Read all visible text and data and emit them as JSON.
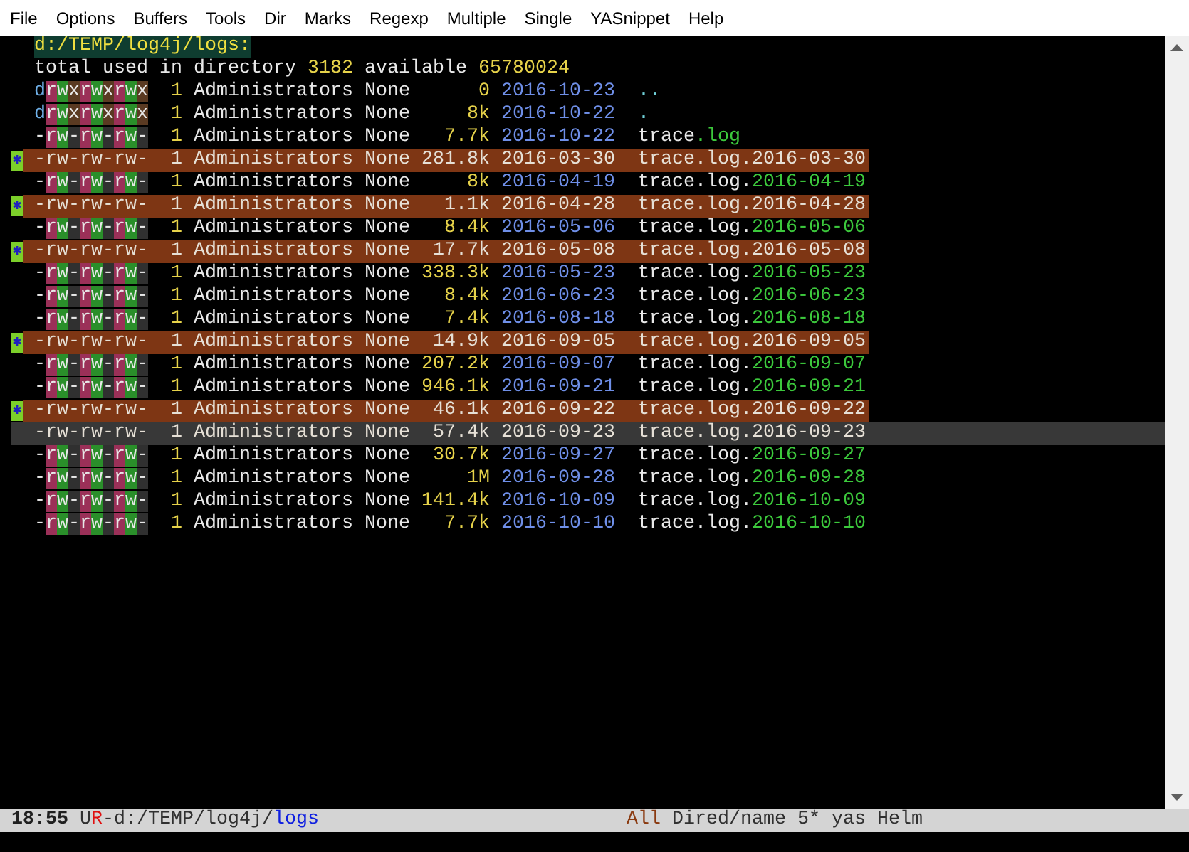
{
  "menu": [
    "File",
    "Options",
    "Buffers",
    "Tools",
    "Dir",
    "Marks",
    "Regexp",
    "Multiple",
    "Single",
    "YASnippet",
    "Help"
  ],
  "header": "d:/TEMP/log4j/logs:",
  "summary": {
    "text": "total used in directory",
    "used": "3182",
    "avail_label": "available",
    "avail": "65780024"
  },
  "rows": [
    {
      "kind": "dir",
      "marked": false,
      "current": false,
      "perms": "drwxrwxrwx",
      "links": "1",
      "owner": "Administrators",
      "group": "None",
      "size": "0",
      "date": "2016-10-23",
      "name": "..",
      "ext": ""
    },
    {
      "kind": "dir",
      "marked": false,
      "current": false,
      "perms": "drwxrwxrwx",
      "links": "1",
      "owner": "Administrators",
      "group": "None",
      "size": "8k",
      "date": "2016-10-22",
      "name": ".",
      "ext": ""
    },
    {
      "kind": "file",
      "marked": false,
      "current": false,
      "perms": "-rw-rw-rw-",
      "links": "1",
      "owner": "Administrators",
      "group": "None",
      "size": "7.7k",
      "date": "2016-10-22",
      "name": "trace",
      "ext": ".log"
    },
    {
      "kind": "file",
      "marked": true,
      "current": false,
      "perms": "-rw-rw-rw-",
      "links": "1",
      "owner": "Administrators",
      "group": "None",
      "size": "281.8k",
      "date": "2016-03-30",
      "name": "trace.log.",
      "ext": "2016-03-30"
    },
    {
      "kind": "file",
      "marked": false,
      "current": false,
      "perms": "-rw-rw-rw-",
      "links": "1",
      "owner": "Administrators",
      "group": "None",
      "size": "8k",
      "date": "2016-04-19",
      "name": "trace.log.",
      "ext": "2016-04-19"
    },
    {
      "kind": "file",
      "marked": true,
      "current": false,
      "perms": "-rw-rw-rw-",
      "links": "1",
      "owner": "Administrators",
      "group": "None",
      "size": "1.1k",
      "date": "2016-04-28",
      "name": "trace.log.",
      "ext": "2016-04-28"
    },
    {
      "kind": "file",
      "marked": false,
      "current": false,
      "perms": "-rw-rw-rw-",
      "links": "1",
      "owner": "Administrators",
      "group": "None",
      "size": "8.4k",
      "date": "2016-05-06",
      "name": "trace.log.",
      "ext": "2016-05-06"
    },
    {
      "kind": "file",
      "marked": true,
      "current": false,
      "perms": "-rw-rw-rw-",
      "links": "1",
      "owner": "Administrators",
      "group": "None",
      "size": "17.7k",
      "date": "2016-05-08",
      "name": "trace.log.",
      "ext": "2016-05-08"
    },
    {
      "kind": "file",
      "marked": false,
      "current": false,
      "perms": "-rw-rw-rw-",
      "links": "1",
      "owner": "Administrators",
      "group": "None",
      "size": "338.3k",
      "date": "2016-05-23",
      "name": "trace.log.",
      "ext": "2016-05-23"
    },
    {
      "kind": "file",
      "marked": false,
      "current": false,
      "perms": "-rw-rw-rw-",
      "links": "1",
      "owner": "Administrators",
      "group": "None",
      "size": "8.4k",
      "date": "2016-06-23",
      "name": "trace.log.",
      "ext": "2016-06-23"
    },
    {
      "kind": "file",
      "marked": false,
      "current": false,
      "perms": "-rw-rw-rw-",
      "links": "1",
      "owner": "Administrators",
      "group": "None",
      "size": "7.4k",
      "date": "2016-08-18",
      "name": "trace.log.",
      "ext": "2016-08-18"
    },
    {
      "kind": "file",
      "marked": true,
      "current": false,
      "perms": "-rw-rw-rw-",
      "links": "1",
      "owner": "Administrators",
      "group": "None",
      "size": "14.9k",
      "date": "2016-09-05",
      "name": "trace.log.",
      "ext": "2016-09-05"
    },
    {
      "kind": "file",
      "marked": false,
      "current": false,
      "perms": "-rw-rw-rw-",
      "links": "1",
      "owner": "Administrators",
      "group": "None",
      "size": "207.2k",
      "date": "2016-09-07",
      "name": "trace.log.",
      "ext": "2016-09-07"
    },
    {
      "kind": "file",
      "marked": false,
      "current": false,
      "perms": "-rw-rw-rw-",
      "links": "1",
      "owner": "Administrators",
      "group": "None",
      "size": "946.1k",
      "date": "2016-09-21",
      "name": "trace.log.",
      "ext": "2016-09-21"
    },
    {
      "kind": "file",
      "marked": true,
      "current": false,
      "perms": "-rw-rw-rw-",
      "links": "1",
      "owner": "Administrators",
      "group": "None",
      "size": "46.1k",
      "date": "2016-09-22",
      "name": "trace.log.",
      "ext": "2016-09-22"
    },
    {
      "kind": "file",
      "marked": false,
      "current": true,
      "perms": "-rw-rw-rw-",
      "links": "1",
      "owner": "Administrators",
      "group": "None",
      "size": "57.4k",
      "date": "2016-09-23",
      "name": "trace.log.",
      "ext": "2016-09-23"
    },
    {
      "kind": "file",
      "marked": false,
      "current": false,
      "perms": "-rw-rw-rw-",
      "links": "1",
      "owner": "Administrators",
      "group": "None",
      "size": "30.7k",
      "date": "2016-09-27",
      "name": "trace.log.",
      "ext": "2016-09-27"
    },
    {
      "kind": "file",
      "marked": false,
      "current": false,
      "perms": "-rw-rw-rw-",
      "links": "1",
      "owner": "Administrators",
      "group": "None",
      "size": "1M",
      "date": "2016-09-28",
      "name": "trace.log.",
      "ext": "2016-09-28"
    },
    {
      "kind": "file",
      "marked": false,
      "current": false,
      "perms": "-rw-rw-rw-",
      "links": "1",
      "owner": "Administrators",
      "group": "None",
      "size": "141.4k",
      "date": "2016-10-09",
      "name": "trace.log.",
      "ext": "2016-10-09"
    },
    {
      "kind": "file",
      "marked": false,
      "current": false,
      "perms": "-rw-rw-rw-",
      "links": "1",
      "owner": "Administrators",
      "group": "None",
      "size": "7.7k",
      "date": "2016-10-10",
      "name": "trace.log.",
      "ext": "2016-10-10"
    }
  ],
  "mode_line": {
    "time": "18:55",
    "flag_a": "U",
    "flag_b": "R",
    "dir": "-d:/TEMP/log4j/",
    "buffer": "logs",
    "position": "All",
    "modes": "Dired/name 5* yas Helm"
  }
}
